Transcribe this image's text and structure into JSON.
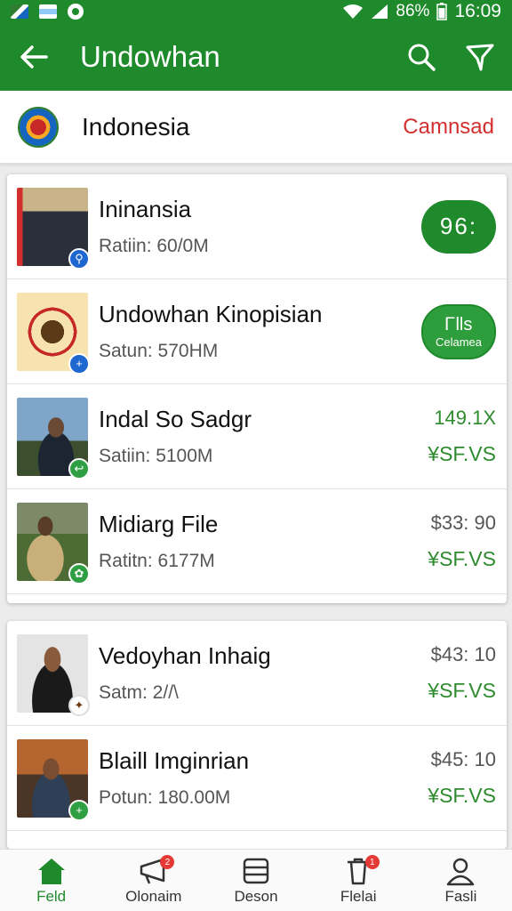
{
  "status_bar": {
    "battery": "86%",
    "time": "16:09"
  },
  "app_bar": {
    "title": "Undowhan"
  },
  "country": {
    "name": "Indonesia",
    "change_label": "Camnsad"
  },
  "list_card_1": [
    {
      "name": "Ininansia",
      "sub": "Ratiin: 60/0M",
      "pill": "96:",
      "badge": "pin"
    },
    {
      "name": "Undowhan Kinopisian",
      "sub": "Satun: 570НM",
      "pill_line1": "Ꮁlls",
      "pill_line2": "Celamea",
      "badge": "plus"
    },
    {
      "name": "Indal So Sadgr",
      "sub": "Satiin: 5100M",
      "price": "149.1X",
      "alt": "¥SF.VS",
      "badge": "share"
    },
    {
      "name": "Midiarg File",
      "sub": "Ratitn: 6177M",
      "price": "$33: 90",
      "alt": "¥SF.VS",
      "badge": "leaf"
    }
  ],
  "list_card_2": [
    {
      "name": "Vedoyhan Inhaig",
      "sub": "Satm: 2//\\",
      "price": "$43: 10",
      "alt": "¥SF.VS",
      "badge": "eagle"
    },
    {
      "name": "Blaill Imginrian",
      "sub": "Potun: 180.00M",
      "price": "$45: 10",
      "alt": "¥SF.VS",
      "badge": "plus"
    }
  ],
  "bottom_nav": [
    {
      "label": "Feld",
      "icon": "home-icon",
      "active": true
    },
    {
      "label": "Olonaim",
      "icon": "megaphone-icon",
      "badge": "2"
    },
    {
      "label": "Deson",
      "icon": "list-icon"
    },
    {
      "label": "Flelai",
      "icon": "trash-icon",
      "badge": "1"
    },
    {
      "label": "Fasli",
      "icon": "person-icon"
    }
  ],
  "colors": {
    "brand": "#1f8a2c",
    "accent_red": "#d32f2f"
  }
}
